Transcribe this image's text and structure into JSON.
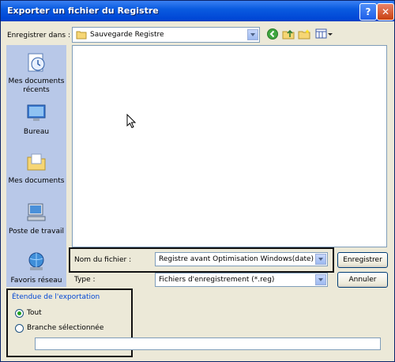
{
  "window": {
    "title": "Exporter un fichier du Registre",
    "help_label": "?",
    "close_label": "✕"
  },
  "save_in": {
    "label": "Enregistrer dans :",
    "value": "Sauvegarde Registre"
  },
  "nav_icons": [
    "back-icon",
    "up-folder-icon",
    "new-folder-icon",
    "view-menu-icon"
  ],
  "places": [
    {
      "label_l1": "Mes documents",
      "label_l2": "récents",
      "icon": "recent-documents-icon"
    },
    {
      "label_l1": "Bureau",
      "label_l2": "",
      "icon": "desktop-icon"
    },
    {
      "label_l1": "Mes documents",
      "label_l2": "",
      "icon": "my-documents-icon"
    },
    {
      "label_l1": "Poste de travail",
      "label_l2": "",
      "icon": "my-computer-icon"
    },
    {
      "label_l1": "Favoris réseau",
      "label_l2": "",
      "icon": "network-places-icon"
    }
  ],
  "filename": {
    "label": "Nom du fichier :",
    "value": "Registre avant Optimisation Windows(date)"
  },
  "filetype": {
    "label": "Type :",
    "value": "Fichiers d'enregistrement (*.reg)"
  },
  "buttons": {
    "save": "Enregistrer",
    "cancel": "Annuler"
  },
  "export_range": {
    "title": "Étendue de l'exportation",
    "option_all": "Tout",
    "option_branch": "Branche sélectionnée",
    "branch_value": "",
    "selected": "all"
  },
  "colors": {
    "titlebar": "#0a5be0",
    "dialog_bg": "#ece9d8",
    "places_bg": "#b8c8e8",
    "highlight_border": "#111111"
  }
}
